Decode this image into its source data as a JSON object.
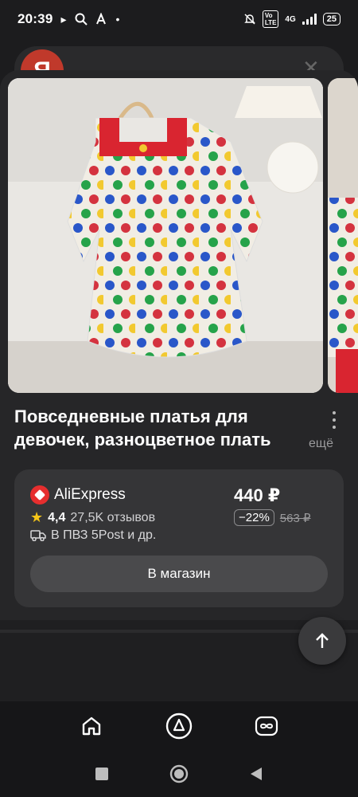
{
  "status_bar": {
    "time": "20:39",
    "network": "4G",
    "battery": "25"
  },
  "background": {
    "logo_letter": "Я"
  },
  "product": {
    "title": "Повседневные платья для девочек, разноцветное плать",
    "more_label": "ещё"
  },
  "offer": {
    "shop_name": "AliExpress",
    "rating": "4,4",
    "reviews": "27,5K отзывов",
    "delivery": "В ПВЗ 5Post и др.",
    "price": "440 ₽",
    "discount": "−22%",
    "old_price": "563 ₽",
    "button_label": "В магазин"
  },
  "icons": {
    "app_nav": [
      "home-icon",
      "alice-icon",
      "infinity-icon"
    ],
    "system_nav": [
      "recents-icon",
      "home-circle-icon",
      "back-icon"
    ]
  },
  "colors": {
    "background": "#1c1c1e",
    "sheet": "#262628",
    "card": "#353537",
    "button": "#4a4a4c",
    "aliexpress_red": "#e62e2e",
    "star": "#f5c518"
  }
}
